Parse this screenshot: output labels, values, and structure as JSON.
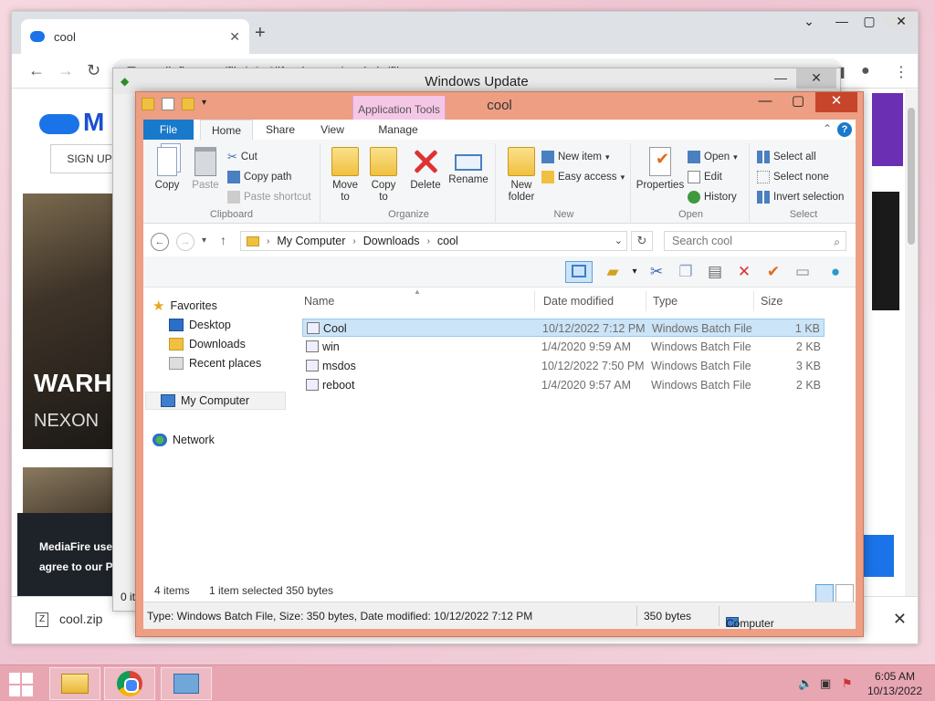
{
  "chrome": {
    "tab_title": "cool",
    "url": "mediafire.com/file/v9p6ilfamipugyu/cool.zip/file",
    "signup": "SIGN UP",
    "ad_title": "WARH",
    "ad_brand": "NEXON",
    "cookie_line1": "MediaFire use",
    "cookie_line2": "agree to our P",
    "download_file": "cool.zip"
  },
  "windows_update": {
    "title": "Windows Update",
    "status": "0 it"
  },
  "explorer": {
    "title": "cool",
    "contextual_group": "Application Tools",
    "tabs": {
      "file": "File",
      "home": "Home",
      "share": "Share",
      "view": "View",
      "manage": "Manage"
    },
    "ribbon": {
      "clipboard": {
        "name": "Clipboard",
        "copy": "Copy",
        "paste": "Paste",
        "cut": "Cut",
        "copy_path": "Copy path",
        "paste_shortcut": "Paste shortcut"
      },
      "organize": {
        "name": "Organize",
        "move_to": "Move to",
        "copy_to": "Copy to",
        "delete": "Delete",
        "rename": "Rename"
      },
      "new": {
        "name": "New",
        "new_folder_1": "New",
        "new_folder_2": "folder",
        "new_item": "New item",
        "easy_access": "Easy access"
      },
      "open": {
        "name": "Open",
        "properties": "Properties",
        "open": "Open",
        "edit": "Edit",
        "history": "History"
      },
      "select": {
        "name": "Select",
        "select_all": "Select all",
        "select_none": "Select none",
        "invert": "Invert selection"
      }
    },
    "address": {
      "crumbs": [
        "My Computer",
        "Downloads",
        "cool"
      ],
      "search_placeholder": "Search cool"
    },
    "nav": {
      "favorites": "Favorites",
      "desktop": "Desktop",
      "downloads": "Downloads",
      "recent": "Recent places",
      "computer": "My Computer",
      "network": "Network"
    },
    "columns": {
      "name": "Name",
      "date": "Date modified",
      "type": "Type",
      "size": "Size"
    },
    "files": [
      {
        "name": "Cool",
        "date": "10/12/2022 7:12 PM",
        "type": "Windows Batch File",
        "size": "1 KB"
      },
      {
        "name": "win",
        "date": "1/4/2020 9:59 AM",
        "type": "Windows Batch File",
        "size": "2 KB"
      },
      {
        "name": "msdos",
        "date": "10/12/2022 7:50 PM",
        "type": "Windows Batch File",
        "size": "3 KB"
      },
      {
        "name": "reboot",
        "date": "1/4/2020 9:57 AM",
        "type": "Windows Batch File",
        "size": "2 KB"
      }
    ],
    "status": {
      "items": "4 items",
      "selected": "1 item selected",
      "bytes": "350 bytes"
    },
    "details": {
      "info": "Type: Windows Batch File, Size: 350 bytes, Date modified: 10/12/2022 7:12 PM",
      "size": "350 bytes",
      "location": "Computer"
    }
  },
  "taskbar": {
    "time": "6:05 AM",
    "date": "10/13/2022"
  }
}
